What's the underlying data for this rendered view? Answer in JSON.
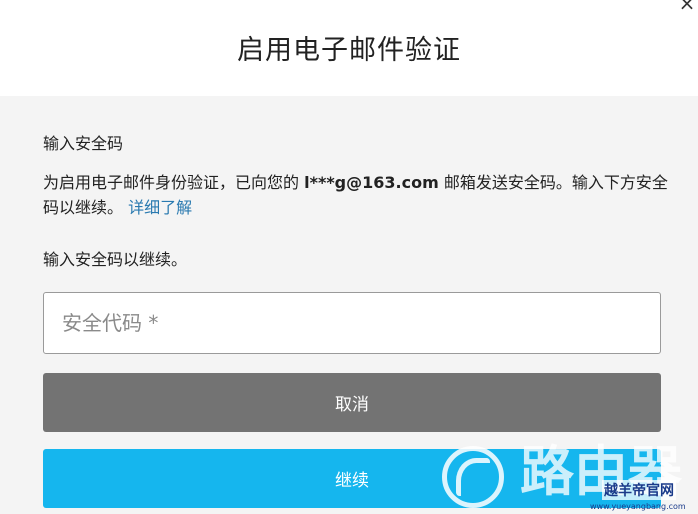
{
  "dialog": {
    "title": "启用电子邮件验证",
    "close_glyph": "×"
  },
  "content": {
    "section_label": "输入安全码",
    "desc_prefix": "为启用电子邮件身份验证，已向您的 ",
    "email": "l***g@163.com",
    "desc_suffix": " 邮箱发送安全码。输入下方安全码以继续。",
    "learn_more": "详细了解",
    "instruction": "输入安全码以继续。"
  },
  "input": {
    "placeholder": "安全代码 *",
    "value": ""
  },
  "buttons": {
    "cancel": "取消",
    "continue": "继续"
  },
  "watermark": {
    "big": "路由器",
    "site_name": "越羊帝官网",
    "site_url": "www.yueyangbang.com"
  },
  "colors": {
    "continue_button": "#15b6ee",
    "cancel_button": "#737373",
    "link": "#2a7ab0",
    "content_background": "#f4f4f4"
  }
}
